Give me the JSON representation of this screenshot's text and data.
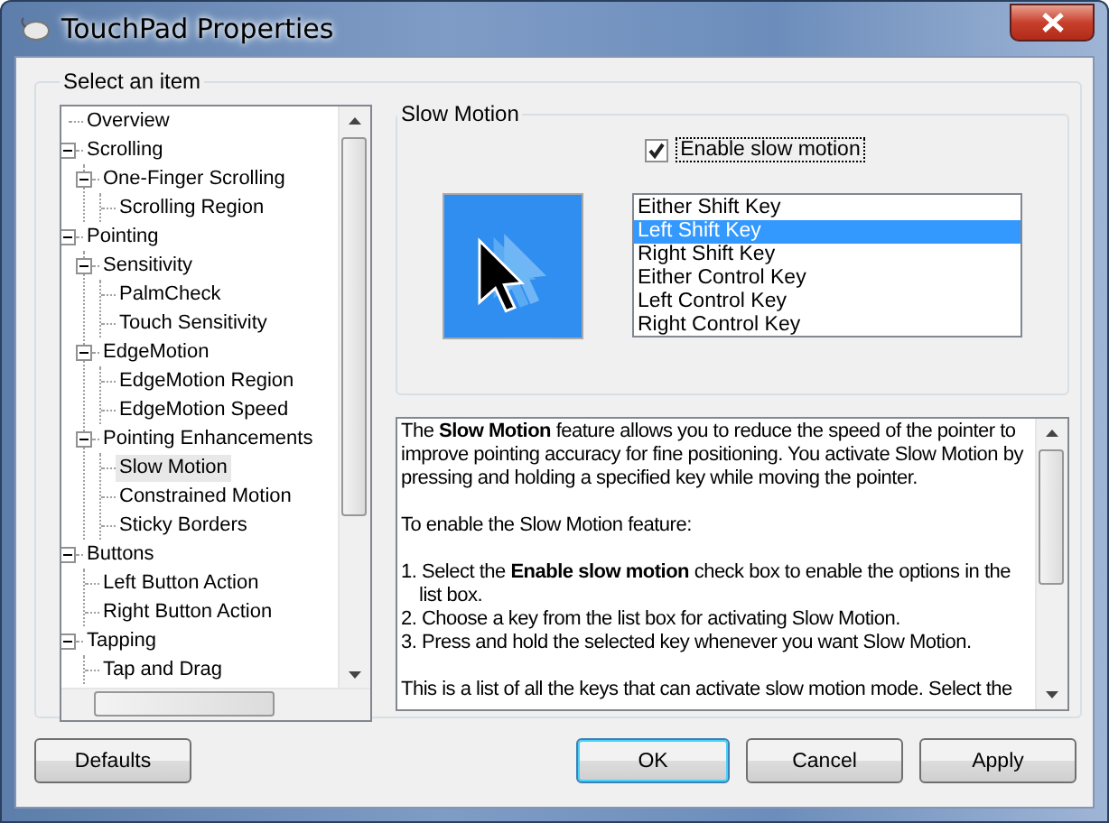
{
  "window": {
    "title": "TouchPad Properties"
  },
  "group": {
    "label": "Select an item"
  },
  "tree": {
    "items": [
      {
        "label": "Overview",
        "selected": false
      },
      {
        "label": "Scrolling",
        "selected": false,
        "expanded": true,
        "children": [
          {
            "label": "One-Finger Scrolling",
            "selected": false,
            "expanded": true,
            "children": [
              {
                "label": "Scrolling Region",
                "selected": false
              }
            ]
          }
        ]
      },
      {
        "label": "Pointing",
        "selected": false,
        "expanded": true,
        "children": [
          {
            "label": "Sensitivity",
            "selected": false,
            "expanded": true,
            "children": [
              {
                "label": "PalmCheck",
                "selected": false
              },
              {
                "label": "Touch Sensitivity",
                "selected": false
              }
            ]
          },
          {
            "label": "EdgeMotion",
            "selected": false,
            "expanded": true,
            "children": [
              {
                "label": "EdgeMotion Region",
                "selected": false
              },
              {
                "label": "EdgeMotion Speed",
                "selected": false
              }
            ]
          },
          {
            "label": "Pointing Enhancements",
            "selected": false,
            "expanded": true,
            "children": [
              {
                "label": "Slow Motion",
                "selected": true
              },
              {
                "label": "Constrained Motion",
                "selected": false
              },
              {
                "label": "Sticky Borders",
                "selected": false
              }
            ]
          }
        ]
      },
      {
        "label": "Buttons",
        "selected": false,
        "expanded": true,
        "children": [
          {
            "label": "Left Button Action",
            "selected": false
          },
          {
            "label": "Right Button Action",
            "selected": false
          }
        ]
      },
      {
        "label": "Tapping",
        "selected": false,
        "expanded": true,
        "children": [
          {
            "label": "Tap and Drag",
            "selected": false
          }
        ]
      }
    ]
  },
  "panel": {
    "label": "Slow Motion",
    "checkbox": {
      "label": "Enable slow motion",
      "checked": true
    },
    "keys": [
      {
        "label": "Either Shift Key",
        "selected": false
      },
      {
        "label": "Left Shift Key",
        "selected": true
      },
      {
        "label": "Right Shift Key",
        "selected": false
      },
      {
        "label": "Either Control Key",
        "selected": false
      },
      {
        "label": "Left Control Key",
        "selected": false
      },
      {
        "label": "Right Control Key",
        "selected": false
      }
    ]
  },
  "description": {
    "blocks": [
      {
        "kind": "paragraph",
        "text": "The **Slow Motion** feature allows you to reduce the speed of the pointer to improve pointing accuracy for fine positioning. You activate Slow Motion by pressing and holding a specified key while moving the pointer."
      },
      {
        "kind": "paragraph",
        "text": "To enable the Slow Motion feature:"
      },
      {
        "kind": "step",
        "text": "1. Select the **Enable slow motion** check box to enable the options in the list box."
      },
      {
        "kind": "step",
        "text": "2. Choose a key from the list box for activating Slow Motion."
      },
      {
        "kind": "step",
        "text": "3. Press and hold the selected key whenever you want Slow Motion."
      },
      {
        "kind": "paragraph",
        "text": "This is a list of all the keys that can activate slow motion mode. Select the"
      }
    ]
  },
  "buttons": [
    {
      "label": "Defaults",
      "kind": "left"
    },
    {
      "label": "OK",
      "kind": "default"
    },
    {
      "label": "Cancel",
      "kind": "normal"
    },
    {
      "label": "Apply",
      "kind": "normal"
    }
  ]
}
